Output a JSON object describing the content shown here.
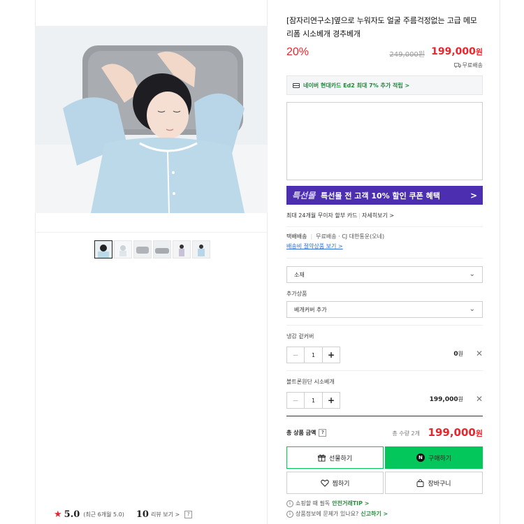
{
  "product": {
    "title": "[잠자리연구소]옆으로 누워자도 얼굴 주름걱정없는 고급 메모리폼 시소베개 경추베개",
    "discount": "20%",
    "original_price": "249,000원",
    "price": "199,000",
    "price_unit": "원",
    "shipping": "무료배송"
  },
  "card_banner": "네이버 현대카드 Ed2 최대 7% 추가 적립 >",
  "promo": {
    "logo": "특선몰",
    "text": "특선몰 전 고객 10% 할인 쿠폰 혜택",
    "arrow": ">"
  },
  "installment": {
    "text": "최대 24개월 무이자 할부 카드",
    "link": "자세히보기 >"
  },
  "delivery": {
    "label": "택배배송",
    "info": "무료배송 · CJ 대한통운(오네)",
    "bundle_link": "배송비 절약상품 보기 >"
  },
  "options": {
    "material_select": "소재",
    "addon_label": "추가상품",
    "addon_select": "베개커버 추가"
  },
  "items": [
    {
      "name": "냉감 겉커버",
      "qty": "1",
      "price": "0",
      "unit": "원"
    },
    {
      "name": "볼트론원단 시소베개",
      "qty": "1",
      "price": "199,000",
      "unit": "원"
    }
  ],
  "total": {
    "label": "총 상품 금액",
    "qty": "총 수량 2개",
    "price": "199,000",
    "unit": "원"
  },
  "buttons": {
    "gift": "선물하기",
    "buy": "구매하기",
    "wish": "찜하기",
    "cart": "장바구니"
  },
  "notices": [
    {
      "text": "쇼핑할 때 필독",
      "link": "안전거래TIP >"
    },
    {
      "text": "상품정보에 문제가 있나요?",
      "link": "신고하기 >"
    }
  ],
  "rating": {
    "score": "5.0",
    "recent": "(최근 6개월 5.0)",
    "review_count": "10",
    "review_link": "리뷰 보기 >"
  },
  "colors": {
    "accent_red": "#e5282d",
    "naver_green": "#03c75a",
    "promo_purple": "#4c2eb0"
  }
}
